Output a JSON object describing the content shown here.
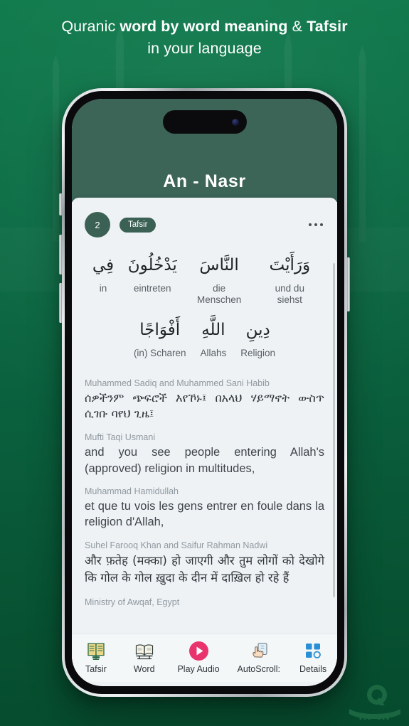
{
  "promo": {
    "line1_prefix": "Quranic ",
    "line1_bold1": "word by word meaning",
    "line1_amp": " & ",
    "line1_bold2": "Tafsir",
    "line2": "in your language"
  },
  "colors": {
    "background_green": "#0c6d45",
    "app_header_green": "#3c6457",
    "badge_green": "#3a6154",
    "content_bg": "#eef2f5",
    "play_pink": "#e8336d",
    "details_blue": "#2b8fd6"
  },
  "app": {
    "surah_title": "An - Nasr",
    "verse": {
      "number": "2",
      "tafsir_label": "Tafsir",
      "more_menu": "more-options"
    },
    "word_by_word": {
      "row1": [
        {
          "arabic": "وَرَأَيْتَ",
          "translation": "und du siehst"
        },
        {
          "arabic": "النَّاسَ",
          "translation": "die Menschen"
        },
        {
          "arabic": "يَدْخُلُونَ",
          "translation": "eintreten"
        },
        {
          "arabic": "فِي",
          "translation": "in"
        }
      ],
      "row2": [
        {
          "arabic": "دِينِ",
          "translation": "Religion"
        },
        {
          "arabic": "اللَّهِ",
          "translation": "Allahs"
        },
        {
          "arabic": "أَفْوَاجًا",
          "translation": "(in) Scharen"
        }
      ]
    },
    "translations": [
      {
        "author": "Muhammed Sadiq and Muhammed Sani Habib",
        "text": "ሰዎችንም ጭፍሮች እየኾኑ፤ በአላህ ሃይማኖት ውስጥ ሲገቡ ባየህ ጊዜ፤",
        "script": "amh"
      },
      {
        "author": "Mufti Taqi Usmani",
        "text": "and you see people entering Allah's (approved) religion in multitudes,",
        "script": "latin"
      },
      {
        "author": "Muhammad Hamidullah",
        "text": "et que tu vois les gens entrer en foule dans la religion d'Allah,",
        "script": "latin"
      },
      {
        "author": "Suhel Farooq Khan and Saifur Rahman Nadwi",
        "text": "और फ़तेह (मक्का) हो जाएगी और तुम लोगों को देखोगे कि गोल के गोल ख़ुदा के दीन में दाख़िल हो रहे हैं",
        "script": "hin"
      },
      {
        "author": "Ministry of Awqaf, Egypt",
        "text": "",
        "script": "latin"
      }
    ],
    "bottom_nav": [
      {
        "label": "Tafsir",
        "icon": "quran-book-icon"
      },
      {
        "label": "Word",
        "icon": "open-book-icon"
      },
      {
        "label": "Play Audio",
        "icon": "play-circle-icon"
      },
      {
        "label": "AutoScroll:",
        "icon": "hand-swipe-icon"
      },
      {
        "label": "Details",
        "icon": "grid-squares-icon"
      }
    ]
  }
}
